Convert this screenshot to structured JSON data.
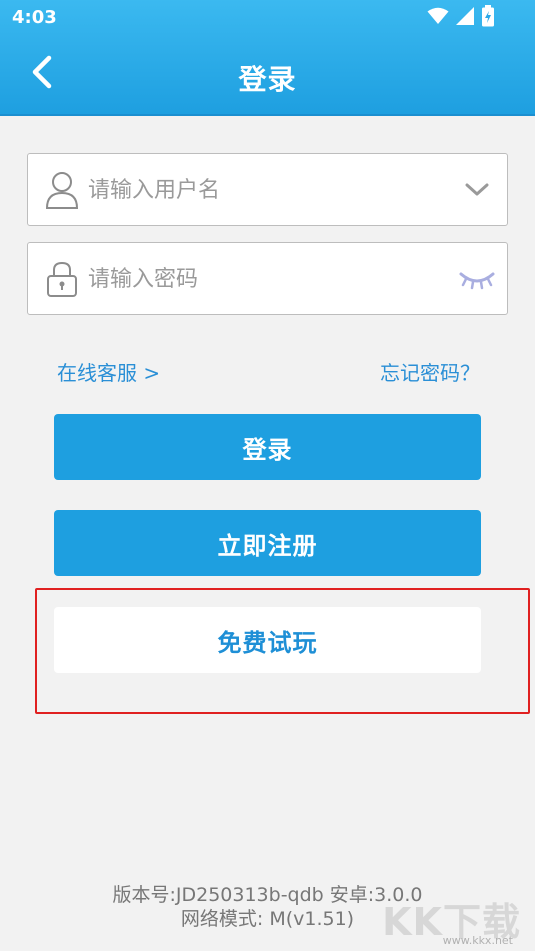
{
  "status_bar": {
    "time": "4:03",
    "icons": [
      "wifi-icon",
      "signal-icon",
      "battery-icon"
    ]
  },
  "header": {
    "title": "登录",
    "back_icon": "chevron-left-icon"
  },
  "form": {
    "username": {
      "placeholder": "请输入用户名",
      "value": "",
      "icon": "user-icon",
      "trailing_icon": "chevron-down-icon"
    },
    "password": {
      "placeholder": "请输入密码",
      "value": "",
      "icon": "lock-icon",
      "trailing_icon": "eye-closed-icon"
    }
  },
  "links": {
    "online_service": "在线客服 >",
    "forgot_password": "忘记密码？"
  },
  "buttons": {
    "login": "登录",
    "register": "立即注册",
    "free_trial": "免费试玩"
  },
  "footer": {
    "version_line": "版本号:JD250313b-qdb  安卓:3.0.0",
    "network_line": "网络模式: M(v1.51)"
  },
  "watermark": {
    "logo": "KK下载",
    "url": "www.kkx.net"
  },
  "colors": {
    "primary": "#1e9fe0",
    "highlight": "#e02020",
    "background": "#f2f2f2"
  }
}
